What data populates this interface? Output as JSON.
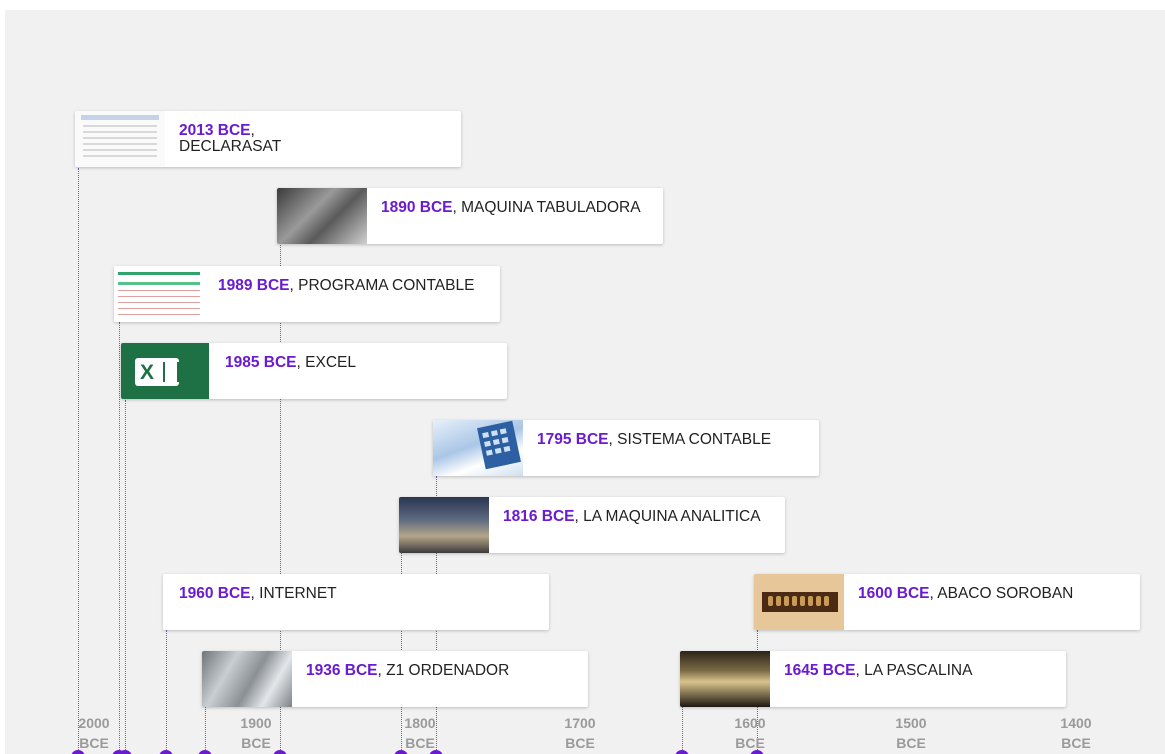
{
  "timeline": {
    "events": [
      {
        "date": "2013 BCE",
        "title": "DECLARASAT",
        "thumb": "spreadsheet-screenshot-thumbnail"
      },
      {
        "date": "1890 BCE",
        "title": "MAQUINA TABULADORA",
        "thumb": "tabulating-machine-photo-thumbnail"
      },
      {
        "date": "1989 BCE",
        "title": "PROGRAMA CONTABLE",
        "thumb": "accounting-program-thumbnail"
      },
      {
        "date": "1985 BCE",
        "title": "EXCEL",
        "thumb": "excel-logo-thumbnail"
      },
      {
        "date": "1795 BCE",
        "title": "SISTEMA CONTABLE",
        "thumb": "calculator-photo-thumbnail"
      },
      {
        "date": "1816 BCE",
        "title": "LA MAQUINA ANALITICA",
        "thumb": "analytical-engine-photo-thumbnail"
      },
      {
        "date": "1960 BCE",
        "title": "INTERNET",
        "thumb": ""
      },
      {
        "date": "1600 BCE",
        "title": "ABACO SOROBAN",
        "thumb": "abacus-photo-thumbnail"
      },
      {
        "date": "1936 BCE",
        "title": "Z1 ORDENADOR",
        "thumb": "z1-computer-photo-thumbnail"
      },
      {
        "date": "1645 BCE",
        "title": "LA PASCALINA",
        "thumb": "pascaline-photo-thumbnail"
      }
    ],
    "axis": {
      "ticks": [
        "2000 BCE",
        "1900 BCE",
        "1800 BCE",
        "1700 BCE",
        "1600 BCE",
        "1500 BCE",
        "1400 BCE"
      ]
    },
    "colors": {
      "accent": "#6a1bd0",
      "background": "#f1f1f1",
      "card": "#ffffff",
      "tick_text": "#9a9a9a"
    }
  }
}
